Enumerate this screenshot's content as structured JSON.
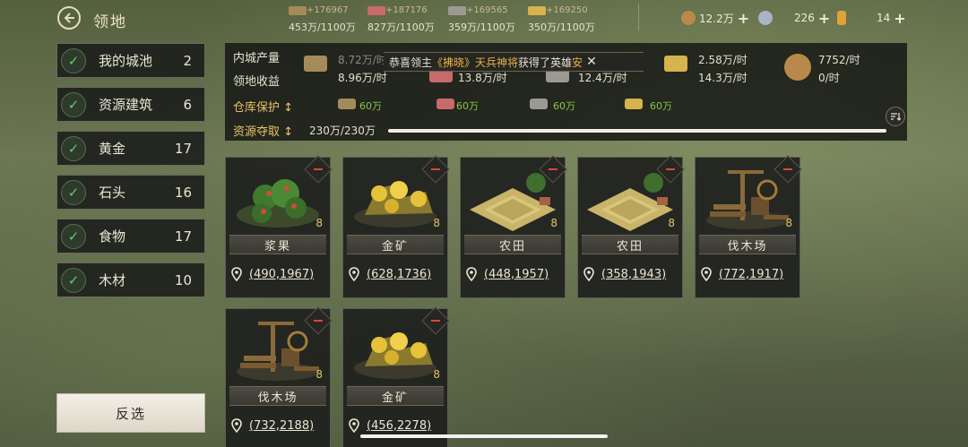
{
  "header": {
    "title": "领地",
    "resources": [
      {
        "name": "wood",
        "gain": "+176967",
        "cap": "453万/1100万",
        "color": "#a58b5a"
      },
      {
        "name": "food",
        "gain": "+187176",
        "cap": "827万/1100万",
        "color": "#c96a6a"
      },
      {
        "name": "stone",
        "gain": "+169565",
        "cap": "359万/1100万",
        "color": "#9a9a92"
      },
      {
        "name": "gold",
        "gain": "+169250",
        "cap": "350万/1100万",
        "color": "#d7b24d"
      }
    ],
    "currencies": [
      {
        "name": "copper-coin",
        "value": "12.2万",
        "color": "#b8894a"
      },
      {
        "name": "silver-coin",
        "value": "226",
        "color": "#a9b4c4"
      },
      {
        "name": "token",
        "value": "14",
        "color": "#e0a33a"
      }
    ]
  },
  "sidebar": {
    "items": [
      {
        "label": "我的城池",
        "count": "2"
      },
      {
        "label": "资源建筑",
        "count": "6"
      },
      {
        "label": "黄金",
        "count": "17"
      },
      {
        "label": "石头",
        "count": "16"
      },
      {
        "label": "食物",
        "count": "17"
      },
      {
        "label": "木材",
        "count": "10"
      }
    ],
    "invert_label": "反选"
  },
  "info": {
    "production_label": "内城产量",
    "income_label": "领地收益",
    "storage_label": "仓库保护",
    "loot_label": "资源夺取",
    "loot_value": "230万/230万",
    "loot_fraction": 1.0,
    "production": [
      {
        "name": "wood",
        "value": "8.72万/时",
        "color": "#a58b5a"
      },
      {
        "name": "gold",
        "value": "2.58万/时",
        "color": "#d7b24d"
      },
      {
        "name": "copper",
        "value": "7752/时",
        "color": "#b8894a"
      }
    ],
    "income": [
      {
        "name": "wood",
        "value": "8.96万/时"
      },
      {
        "name": "food",
        "value": "13.8万/时"
      },
      {
        "name": "stone",
        "value": "12.4万/时"
      },
      {
        "name": "gold",
        "value": "14.3万/时"
      },
      {
        "name": "copper",
        "value": "0/时"
      }
    ],
    "storage": [
      {
        "name": "wood",
        "value": "60万",
        "color": "#a58b5a"
      },
      {
        "name": "food",
        "value": "60万",
        "color": "#c96a6a"
      },
      {
        "name": "stone",
        "value": "60万",
        "color": "#9a9a92"
      },
      {
        "name": "gold",
        "value": "60万",
        "color": "#d7b24d"
      }
    ]
  },
  "toast": {
    "p1": "恭喜领主",
    "p2": "《拂晓》天兵神将",
    "p3": "获得了英雄",
    "p4": "安"
  },
  "cards": [
    {
      "name": "浆果",
      "level": "8",
      "coord": "(490,1967)",
      "kind": "berry"
    },
    {
      "name": "金矿",
      "level": "8",
      "coord": "(628,1736)",
      "kind": "gold"
    },
    {
      "name": "农田",
      "level": "8",
      "coord": "(448,1957)",
      "kind": "farm"
    },
    {
      "name": "农田",
      "level": "8",
      "coord": "(358,1943)",
      "kind": "farm"
    },
    {
      "name": "伐木场",
      "level": "8",
      "coord": "(772,1917)",
      "kind": "lumber"
    },
    {
      "name": "伐木场",
      "level": "8",
      "coord": "(732,2188)",
      "kind": "lumber"
    },
    {
      "name": "金矿",
      "level": "8",
      "coord": "(456,2278)",
      "kind": "gold"
    }
  ]
}
